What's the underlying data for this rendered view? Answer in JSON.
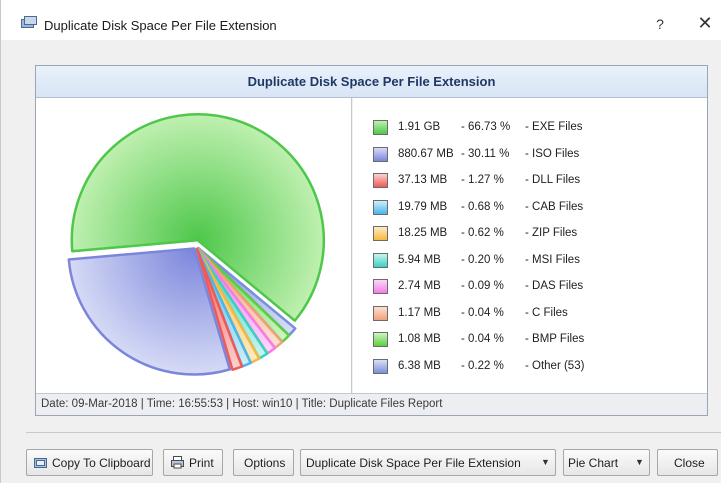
{
  "window": {
    "title": "Duplicate Disk Space Per File Extension",
    "help_label": "?",
    "close_label": "✕"
  },
  "panel": {
    "title": "Duplicate Disk Space Per File Extension",
    "footer": "Date: 09-Mar-2018 | Time: 16:55:53 | Host: win10 | Title: Duplicate Files Report"
  },
  "chart_data": {
    "type": "pie",
    "title": "Duplicate Disk Space Per File Extension",
    "slices": [
      {
        "label": "EXE Files",
        "size": "1.91 GB",
        "pct_text": "- 66.73 %",
        "value": 66.73,
        "color": "#4ec74a",
        "light": "#bff0b0"
      },
      {
        "label": "ISO Files",
        "size": "880.67 MB",
        "pct_text": "- 30.11 %",
        "value": 30.11,
        "color": "#7b86db",
        "light": "#d6daf6"
      },
      {
        "label": "DLL Files",
        "size": "37.13 MB",
        "pct_text": "- 1.27 %",
        "value": 1.27,
        "color": "#ef5a56",
        "light": "#fbd2d0"
      },
      {
        "label": "CAB Files",
        "size": "19.79 MB",
        "pct_text": "- 0.68 %",
        "value": 0.68,
        "color": "#49b7ea",
        "light": "#cdeefb"
      },
      {
        "label": "ZIP Files",
        "size": "18.25 MB",
        "pct_text": "- 0.62 %",
        "value": 0.62,
        "color": "#f5b941",
        "light": "#fdebc4"
      },
      {
        "label": "MSI Files",
        "size": "5.94 MB",
        "pct_text": "- 0.20 %",
        "value": 0.2,
        "color": "#39d1c2",
        "light": "#c8f4ef"
      },
      {
        "label": "DAS Files",
        "size": "2.74 MB",
        "pct_text": "- 0.09 %",
        "value": 0.09,
        "color": "#f37de9",
        "light": "#fcd6f8"
      },
      {
        "label": "C Files",
        "size": "1.17 MB",
        "pct_text": "- 0.04 %",
        "value": 0.04,
        "color": "#f1a07b",
        "light": "#fce0d2"
      },
      {
        "label": "BMP Files",
        "size": "1.08 MB",
        "pct_text": "- 0.04 %",
        "value": 0.04,
        "color": "#5bcf3f",
        "light": "#d0f4c4"
      },
      {
        "label": "Other (53)",
        "size": "6.38 MB",
        "pct_text": "- 0.22 %",
        "value": 0.22,
        "color": "#7a8fdc",
        "light": "#d8dff7"
      }
    ]
  },
  "toolbar": {
    "copy_label": "Copy To Clipboard",
    "print_label": "Print",
    "options_label": "Options",
    "report_select": "Duplicate Disk Space Per File Extension",
    "chart_type_select": "Pie Chart",
    "close_label": "Close"
  }
}
